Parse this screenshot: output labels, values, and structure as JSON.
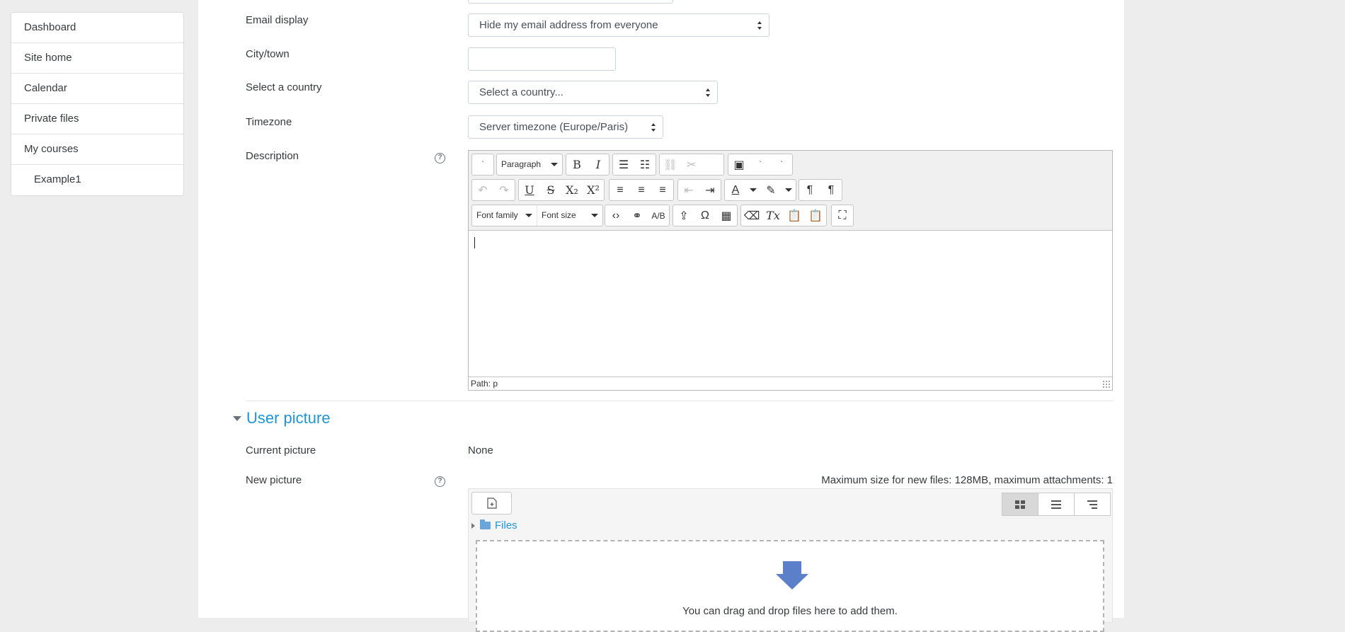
{
  "sidebar": {
    "items": [
      {
        "label": "Dashboard"
      },
      {
        "label": "Site home"
      },
      {
        "label": "Calendar"
      },
      {
        "label": "Private files"
      },
      {
        "label": "My courses"
      },
      {
        "label": "Example1"
      }
    ]
  },
  "form": {
    "email_display": {
      "label": "Email display",
      "value": "Hide my email address from everyone"
    },
    "city": {
      "label": "City/town",
      "value": ""
    },
    "country": {
      "label": "Select a country",
      "value": "Select a country..."
    },
    "timezone": {
      "label": "Timezone",
      "value": "Server timezone (Europe/Paris)"
    },
    "description": {
      "label": "Description",
      "help_icon": "?",
      "toolbar": {
        "block_format": "Paragraph",
        "font_family": "Font family",
        "font_size": "Font size"
      },
      "path": "Path: p"
    }
  },
  "user_picture": {
    "section_title": "User picture",
    "current_picture": {
      "label": "Current picture",
      "value": "None"
    },
    "new_picture": {
      "label": "New picture",
      "help_icon": "?",
      "max_size": "Maximum size for new files: 128MB, maximum attachments: 1",
      "files_label": "Files",
      "drop_text": "You can drag and drop files here to add them."
    }
  },
  "colors": {
    "link": "#1f95d6",
    "page_bg": "#ededed",
    "drop_arrow": "#5b7fc9"
  }
}
